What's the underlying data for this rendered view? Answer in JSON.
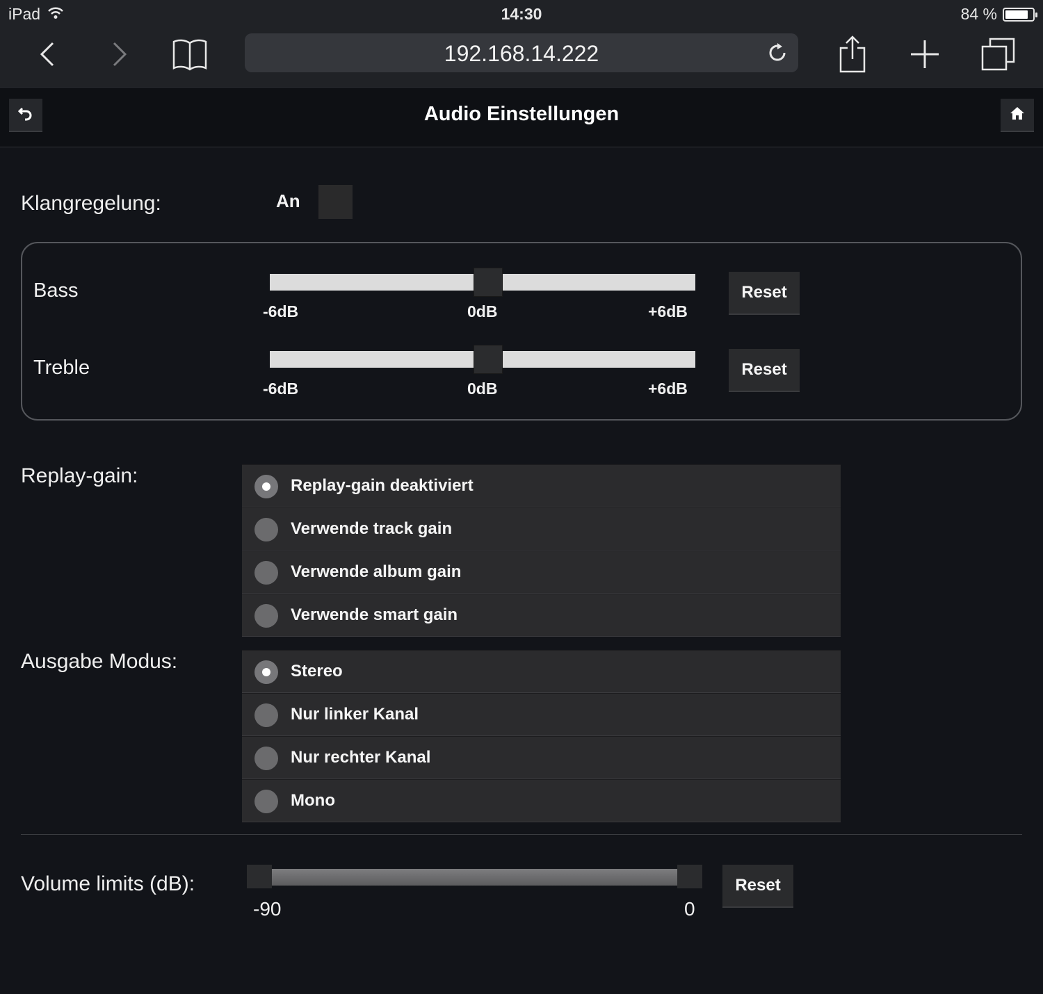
{
  "status_bar": {
    "device": "iPad",
    "time": "14:30",
    "battery": "84 %",
    "battery_level": 0.84
  },
  "browser": {
    "url": "192.168.14.222",
    "icons": [
      "back-arrow-icon",
      "forward-arrow-icon",
      "bookmarks-book-icon",
      "reload-icon",
      "share-icon",
      "new-tab-plus-icon",
      "tabs-overview-icon"
    ]
  },
  "header": {
    "title": "Audio Einstellungen",
    "back_icon": "undo-arrow-icon",
    "home_icon": "home-icon"
  },
  "tone_control": {
    "label": "Klangregelung:",
    "toggle_label": "An",
    "enabled": false,
    "bass": {
      "label": "Bass",
      "value_db": 0,
      "min_label": "-6dB",
      "mid_label": "0dB",
      "max_label": "+6dB",
      "reset_label": "Reset"
    },
    "treble": {
      "label": "Treble",
      "value_db": 0,
      "min_label": "-6dB",
      "mid_label": "0dB",
      "max_label": "+6dB",
      "reset_label": "Reset"
    }
  },
  "replay_gain": {
    "label": "Replay-gain:",
    "options": [
      {
        "label": "Replay-gain deaktiviert",
        "selected": true
      },
      {
        "label": "Verwende track gain",
        "selected": false
      },
      {
        "label": "Verwende album gain",
        "selected": false
      },
      {
        "label": "Verwende smart gain",
        "selected": false
      }
    ]
  },
  "output_mode": {
    "label": "Ausgabe Modus:",
    "options": [
      {
        "label": "Stereo",
        "selected": true
      },
      {
        "label": "Nur linker Kanal",
        "selected": false
      },
      {
        "label": "Nur rechter Kanal",
        "selected": false
      },
      {
        "label": "Mono",
        "selected": false
      }
    ]
  },
  "volume_limits": {
    "label": "Volume limits (dB):",
    "min_label": "-90",
    "max_label": "0",
    "low_value": -90,
    "high_value": 0,
    "reset_label": "Reset"
  },
  "colors": {
    "background": "#121419",
    "chrome": "#202226",
    "button": "#2a2b2d",
    "track": "#dcdcdc"
  }
}
